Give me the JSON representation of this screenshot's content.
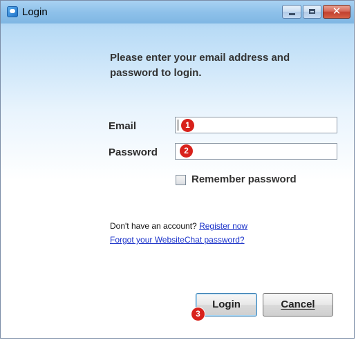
{
  "window": {
    "title": "Login",
    "icon": "app-chat-icon",
    "controls": {
      "minimize_icon": "minimize-icon",
      "maximize_icon": "maximize-icon",
      "close_glyph": "✕"
    }
  },
  "instruction": "Please enter your email address and password to login.",
  "form": {
    "email_label": "Email",
    "email_value": "",
    "password_label": "Password",
    "password_value": "",
    "remember_label": "Remember password",
    "remember_checked": false
  },
  "links": {
    "no_account_text": "Don't have an account?",
    "register_label": "Register now",
    "forgot_label": "Forgot your WebsiteChat password?"
  },
  "buttons": {
    "login_label": "Login",
    "cancel_label": "Cancel"
  },
  "markers": {
    "m1": "1",
    "m2": "2",
    "m3": "3"
  },
  "colors": {
    "marker": "#d8211b",
    "link": "#1a32c9",
    "close_button": "#c2412f"
  }
}
